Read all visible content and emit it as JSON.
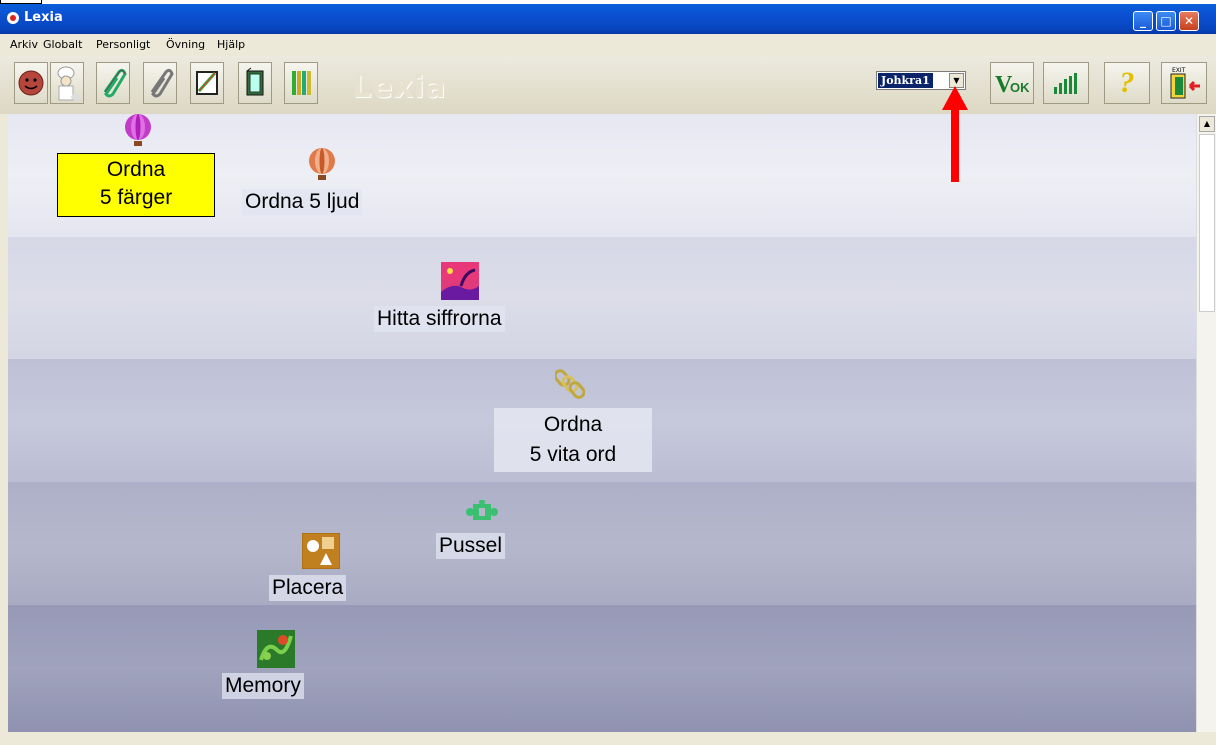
{
  "window": {
    "title": "Lexia",
    "min": "_",
    "max": "□",
    "close": "✕"
  },
  "menu": [
    "Arkiv",
    "Globalt",
    "Personligt",
    "Övning",
    "Hjälp"
  ],
  "toolbar": {
    "logo": "Lexia",
    "user_select": "Johkra1",
    "ok_label": "V",
    "ok_sub": "OK",
    "help": "?",
    "exit_label": "EXIT"
  },
  "exercises": [
    {
      "line1": "Ordna",
      "line2": "5 färger",
      "selected": true,
      "icon": "balloon-pink-icon"
    },
    {
      "line1": "Ordna 5 ljud",
      "icon": "balloon-orange-icon"
    },
    {
      "line1": "Hitta siffrorna",
      "icon": "landscape-picture-icon"
    },
    {
      "line1": "Ordna",
      "line2": "5 vita ord",
      "icon": "chain-links-icon"
    },
    {
      "line1": "Pussel",
      "icon": "puzzle-piece-icon"
    },
    {
      "line1": "Placera",
      "icon": "shapes-icon"
    },
    {
      "line1": "Memory",
      "icon": "memory-cards-icon"
    }
  ],
  "colors": {
    "selected": "#ffff00",
    "titlebar": "#0b4fd1",
    "arrow": "#ff0000"
  }
}
